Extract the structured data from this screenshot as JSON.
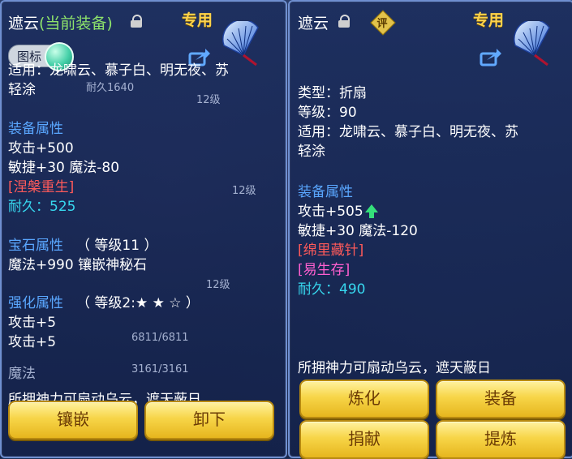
{
  "left": {
    "title_name": "遮云",
    "title_status": "(当前装备)",
    "special_label": "专用",
    "toggle_label": "图标",
    "applicable_line1": "适用：龙啸云、慕子白、明无夜、苏",
    "applicable_line2": "轻涂",
    "equip_attr_header": "装备属性",
    "attack": "攻击+500",
    "agility_magic": "敏捷+30 魔法-80",
    "special_effect": "[涅槃重生]",
    "durability": "耐久：525",
    "gem_header": "宝石属性",
    "gem_level": "（ 等级11 ）",
    "gem_value": "魔法+990 镶嵌神秘石",
    "enhance_header": "强化属性",
    "enhance_level": "（ 等级2:★ ★ ☆ ）",
    "enhance_attack1": "攻击+5",
    "enhance_attack2": "攻击+5",
    "bg_durability": "耐久1640",
    "bg_level_a": "12级",
    "bg_level_b": "12级",
    "bg_level_c": "12级",
    "bg_hp": "6811/6811",
    "bg_mp_label": "魔法",
    "bg_mp": "3161/3161",
    "description": "所拥神力可扇动乌云，遮天蔽日",
    "buttons": [
      "镶嵌",
      "卸下"
    ]
  },
  "right": {
    "title_name": "遮云",
    "eval_badge": "评",
    "special_label": "专用",
    "type": "类型：折扇",
    "level": "等级：90",
    "applicable_line1": "适用：龙啸云、慕子白、明无夜、苏",
    "applicable_line2": "轻涂",
    "equip_attr_header": "装备属性",
    "attack": "攻击+505",
    "agility_magic": "敏捷+30 魔法-120",
    "special_effect1": "[绵里藏针]",
    "special_effect2": "[易生存]",
    "durability": "耐久：490",
    "description": "所拥神力可扇动乌云，遮天蔽日",
    "buttons": [
      "炼化",
      "装备",
      "捐献",
      "提炼"
    ]
  },
  "colors": {
    "panel_border": "#6f8fd0",
    "gold_button": "#f7d548",
    "header_blue": "#5aa7ff",
    "effect_red": "#ff5a5a",
    "durability_cyan": "#37d7ee",
    "effect_pink": "#ff5fd0"
  },
  "icons": [
    "lock-icon",
    "fan-icon",
    "share-icon",
    "upgrade-arrow-icon"
  ]
}
